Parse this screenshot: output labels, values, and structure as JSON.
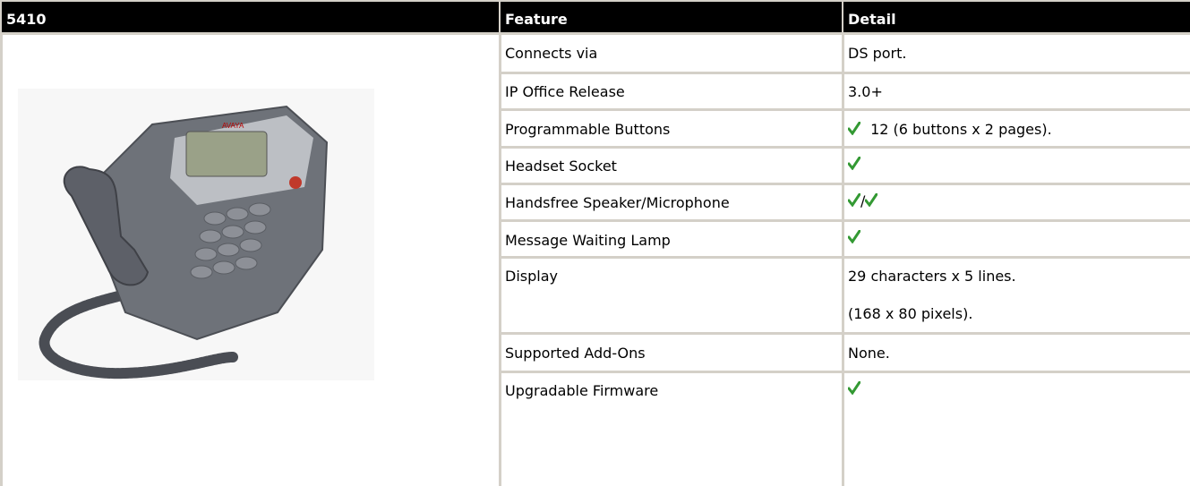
{
  "header": {
    "model": "5410",
    "feature": "Feature",
    "detail": "Detail"
  },
  "image": {
    "logo_text": "AVAYA",
    "alt": "phone"
  },
  "rows": [
    {
      "feature": "Connects via",
      "detail": "DS port."
    },
    {
      "feature": "IP Office Release",
      "detail": "3.0+"
    },
    {
      "feature": "Programmable Buttons",
      "detail": "12 (6 buttons x 2 pages)."
    },
    {
      "feature": "Headset Socket",
      "detail": ""
    },
    {
      "feature": "Handsfree Speaker/Microphone",
      "detail": "/"
    },
    {
      "feature": "Message Waiting Lamp",
      "detail": ""
    },
    {
      "feature": "Display",
      "detail": "29 characters x 5 lines.",
      "detail2": "(168 x 80 pixels)."
    },
    {
      "feature": "Supported Add-Ons",
      "detail": "None."
    },
    {
      "feature": "Upgradable Firmware",
      "detail": ""
    }
  ],
  "colors": {
    "header_bg": "#000000",
    "header_fg": "#ffffff",
    "grid": "#d4d0c8",
    "check": "#339933"
  },
  "icons": {
    "check": "checkmark-icon"
  }
}
